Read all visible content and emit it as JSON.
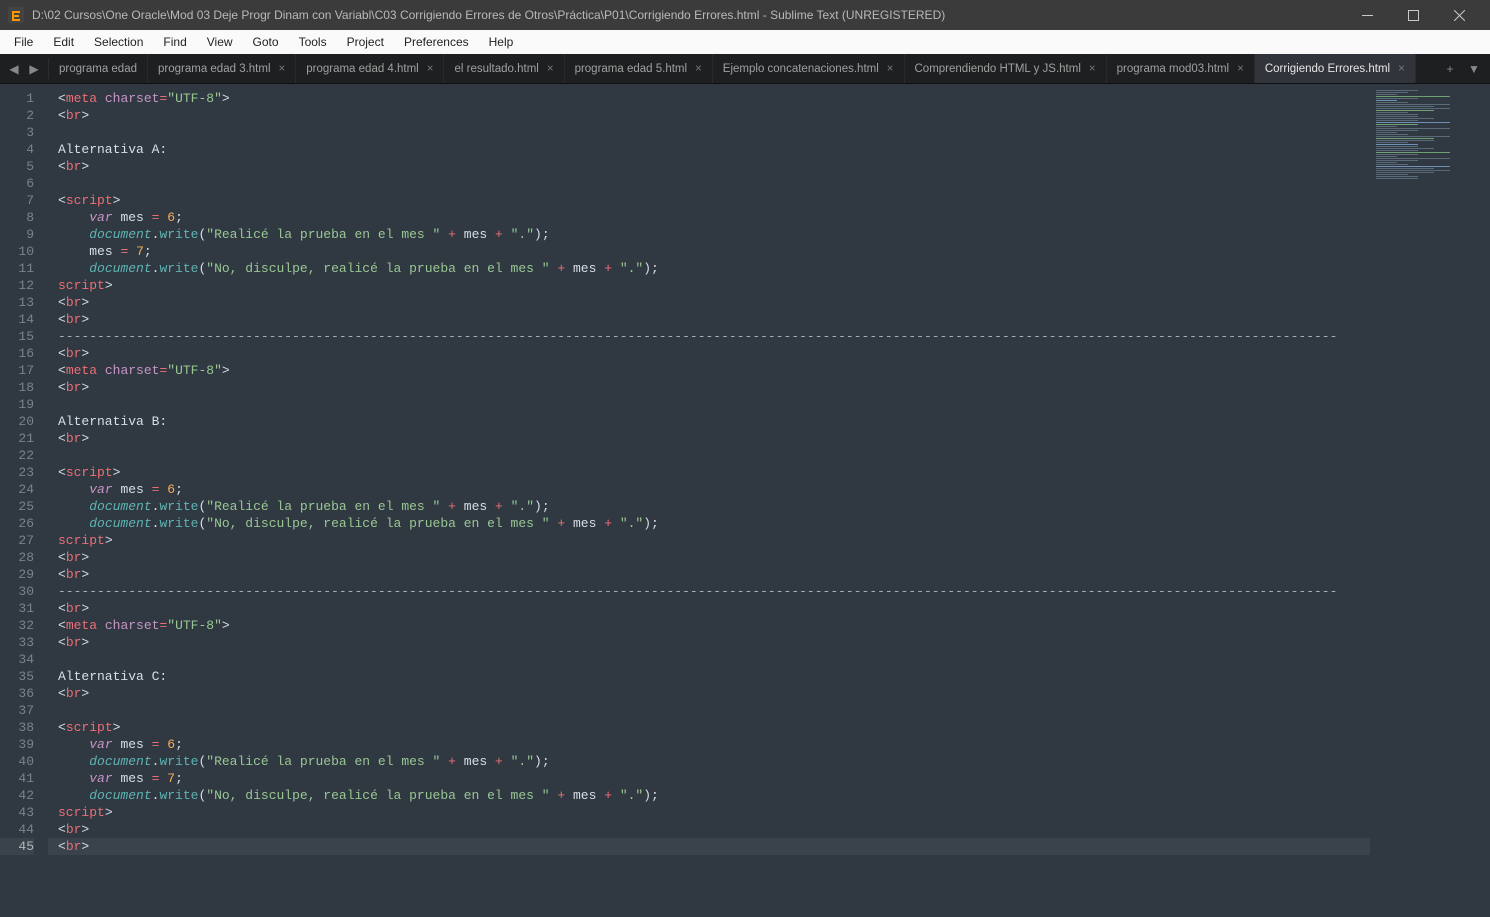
{
  "title": "D:\\02 Cursos\\One Oracle\\Mod 03 Deje Progr Dinam con Variabl\\C03 Corrigiendo Errores de Otros\\Práctica\\P01\\Corrigiendo Errores.html - Sublime Text (UNREGISTERED)",
  "menu": [
    "File",
    "Edit",
    "Selection",
    "Find",
    "View",
    "Goto",
    "Tools",
    "Project",
    "Preferences",
    "Help"
  ],
  "tabs": [
    {
      "label": "programa edad",
      "active": false
    },
    {
      "label": "programa edad 3.html",
      "active": false
    },
    {
      "label": "programa edad 4.html",
      "active": false
    },
    {
      "label": "el resultado.html",
      "active": false
    },
    {
      "label": "programa edad 5.html",
      "active": false
    },
    {
      "label": "Ejemplo concatenaciones.html",
      "active": false
    },
    {
      "label": "Comprendiendo HTML y JS.html",
      "active": false
    },
    {
      "label": "programa mod03.html",
      "active": false
    },
    {
      "label": "Corrigiendo Errores.html",
      "active": true
    }
  ],
  "alts": {
    "a": "Alternativa A:",
    "b": "Alternativa B:",
    "c": "Alternativa C:"
  },
  "tok": {
    "meta": "meta",
    "br": "br",
    "script": "script",
    "charset": "charset",
    "utf8": "\"UTF-8\"",
    "var": "var",
    "mes": "mes",
    "eq": "=",
    "semi": ";",
    "n6": "6",
    "n7": "7",
    "doc": "document",
    "dot": ".",
    "write": "write",
    "lp": "(",
    "rp": ")",
    "plus": "+",
    "lt": "<",
    "gt": ">",
    "sl": "/",
    "s1": "\"Realicé la prueba en el mes \"",
    "s2": "\"No, disculpe, realicé la prueba en el mes \"",
    "sdot": "\".\"",
    "dashline": "--------------------------------------------------------------------------------------------------------------------------------------------------------------------"
  },
  "line_count": 45,
  "current_line": 45,
  "icons": {
    "tab_close": "×",
    "nav_left": "◀",
    "nav_right": "▶",
    "plus": "+",
    "dropdown": "▼"
  }
}
